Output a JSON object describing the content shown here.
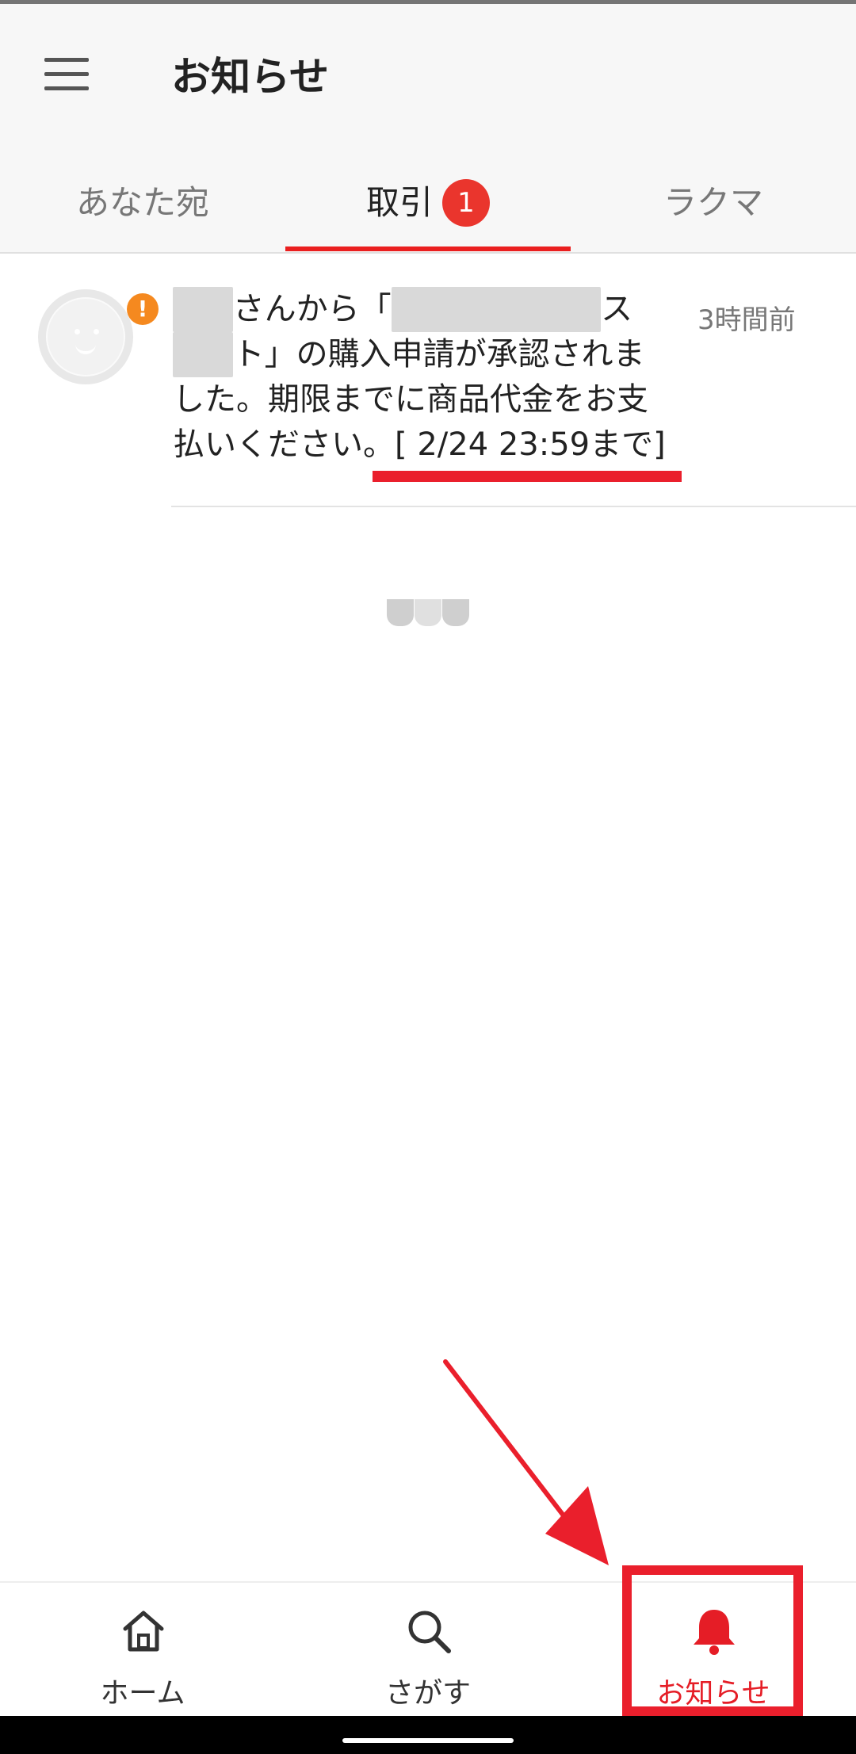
{
  "header": {
    "title": "お知らせ"
  },
  "tabs": [
    {
      "label": "あなた宛"
    },
    {
      "label": "取引",
      "badge": "1"
    },
    {
      "label": "ラクマ"
    }
  ],
  "notification": {
    "line1_post": "さんから「",
    "line1_tail": "ス",
    "line2_tail": "ト」の購入申請が承認されま",
    "line3": "した。期限までに商品代金をお支",
    "line4_pre": "払いください。",
    "deadline": "[ 2/24 23:59まで]",
    "time": "3時間前",
    "alert": "!"
  },
  "bottom_nav": {
    "home": "ホーム",
    "search": "さがす",
    "notice": "お知らせ"
  },
  "colors": {
    "accent": "#ea1f2c",
    "badge": "#ea352d",
    "alert": "#f5891f"
  },
  "icons": [
    "menu-icon",
    "avatar-face-icon",
    "home-icon",
    "search-icon",
    "bell-icon"
  ]
}
